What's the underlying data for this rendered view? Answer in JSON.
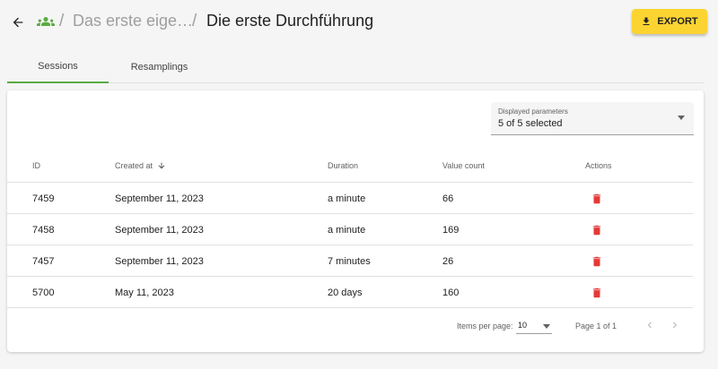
{
  "header": {
    "back_icon": "arrow-left-icon",
    "group_icon": "people-group-icon",
    "group_icon_color": "#5aaa42",
    "separator": "/",
    "parent": "Das erste eige…",
    "title": "Die erste Durchführung",
    "export_label": "EXPORT",
    "export_icon": "download-icon",
    "export_color": "#fbd432"
  },
  "tabs": [
    {
      "label": "Sessions",
      "active": true
    },
    {
      "label": "Resamplings",
      "active": false
    }
  ],
  "accent_color": "#5aaa42",
  "filter": {
    "label": "Displayed parameters",
    "value": "5 of 5 selected"
  },
  "table": {
    "columns": [
      "ID",
      "Created at",
      "Duration",
      "Value count",
      "Actions"
    ],
    "sort_icon": "arrow-down-icon",
    "delete_icon": "trash-icon",
    "delete_color": "#e53935",
    "rows": [
      {
        "id": "7459",
        "created": "September 11, 2023",
        "duration": "a minute",
        "value_count": "66"
      },
      {
        "id": "7458",
        "created": "September 11, 2023",
        "duration": "a minute",
        "value_count": "169"
      },
      {
        "id": "7457",
        "created": "September 11, 2023",
        "duration": "7 minutes",
        "value_count": "26"
      },
      {
        "id": "5700",
        "created": "May 11, 2023",
        "duration": "20 days",
        "value_count": "160"
      }
    ]
  },
  "pagination": {
    "items_label": "Items per page:",
    "items_value": "10",
    "range": "Page 1 of 1"
  }
}
